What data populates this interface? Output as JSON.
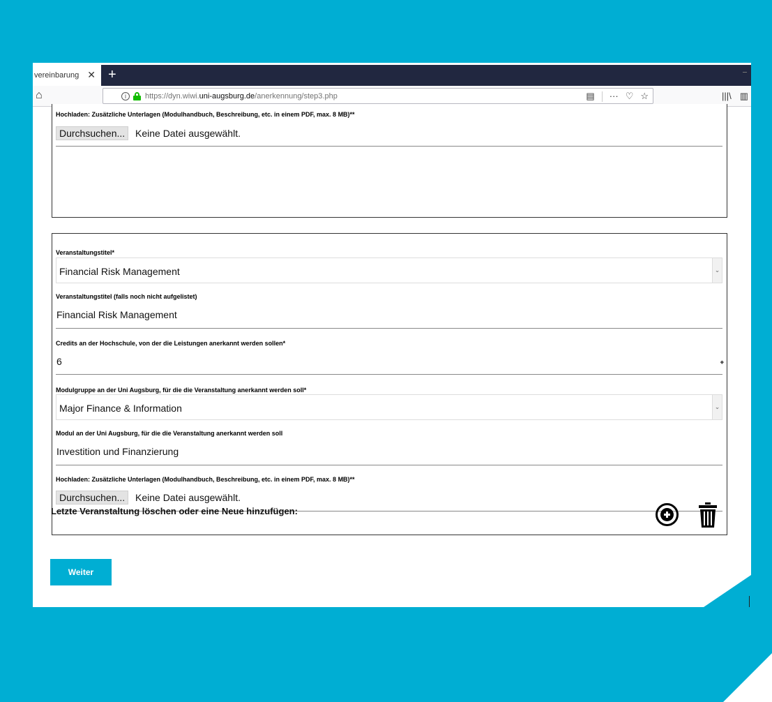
{
  "browser": {
    "tab_title": "vereinbarung",
    "tab_close": "✕",
    "new_tab": "+",
    "url_prefix": "https://dyn.wiwi.",
    "url_domain": "uni-augsburg.de",
    "url_path": "/anerkennung/step3.php"
  },
  "card1": {
    "upload_label": "Hochladen: Zusätzliche Unterlagen (Modulhandbuch, Beschreibung, etc. in einem PDF, max. 8 MB)**",
    "browse_button": "Durchsuchen...",
    "no_file": "Keine Datei ausgewählt."
  },
  "card2": {
    "title_label": "Veranstaltungstitel*",
    "title_value": "Financial Risk Management",
    "title_other_label": "Veranstaltungstitel (falls noch nicht aufgelistet)",
    "title_other_value": "Financial Risk Management",
    "credits_label": "Credits an der Hochschule, von der die Leistungen anerkannt werden sollen*",
    "credits_value": "6",
    "modulgruppe_label": "Modulgruppe an der Uni Augsburg, für die die Veranstaltung anerkannt werden soll*",
    "modulgruppe_value": "Major Finance & Information",
    "modul_label": "Modul an der Uni Augsburg, für die die Veranstaltung anerkannt werden soll",
    "modul_value": "Investition und Finanzierung",
    "upload_label": "Hochladen: Zusätzliche Unterlagen (Modulhandbuch, Beschreibung, etc. in einem PDF, max. 8 MB)**",
    "browse_button": "Durchsuchen...",
    "no_file": "Keine Datei ausgewählt."
  },
  "actions": {
    "delete_add_label": "Letzte Veranstaltung löschen oder eine Neue hinzufügen:",
    "weiter_button": "Weiter"
  },
  "colors": {
    "accent": "#00aed3",
    "tabbar": "#212740"
  }
}
